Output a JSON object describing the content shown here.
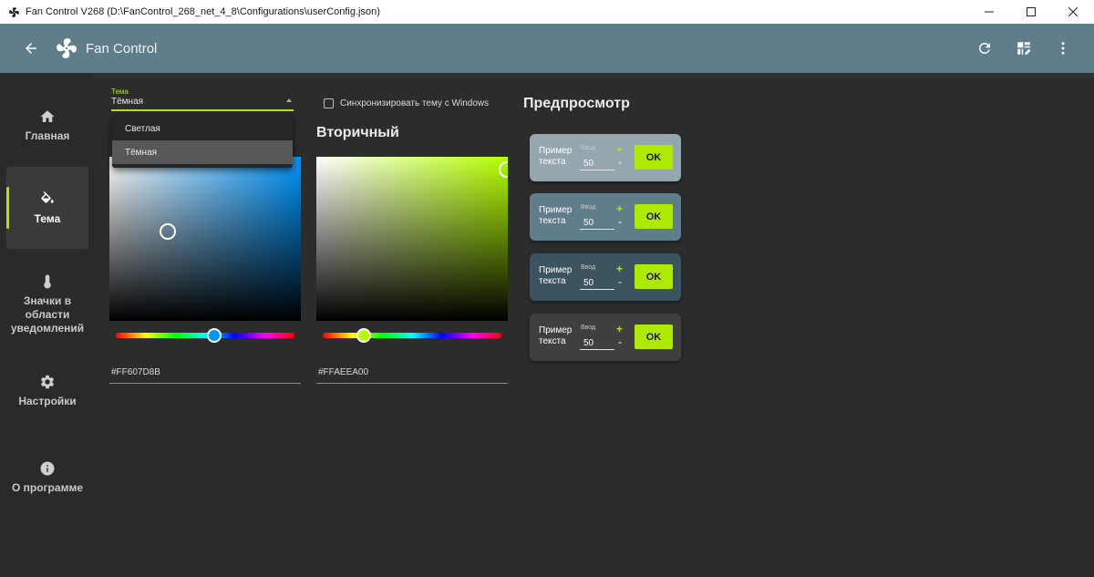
{
  "window": {
    "title": "Fan Control V268 (D:\\FanControl_268_net_4_8\\Configurations\\userConfig.json)"
  },
  "appbar": {
    "title": "Fan Control",
    "icons": [
      "back-arrow-icon",
      "fan-logo-icon",
      "refresh-icon",
      "dashboard-edit-icon",
      "more-vertical-icon"
    ]
  },
  "sidebar": {
    "items": [
      {
        "label": "Главная",
        "icon": "home-icon"
      },
      {
        "label": "Тема",
        "icon": "paint-bucket-icon",
        "active": true
      },
      {
        "label": "Значки в области уведомлений",
        "icon": "thermometer-icon"
      },
      {
        "label": "Настройки",
        "icon": "gear-icon"
      },
      {
        "label": "О программе",
        "icon": "info-icon"
      }
    ]
  },
  "theme": {
    "label": "Тема",
    "value": "Тёмная",
    "options": [
      "Светлая",
      "Тёмная"
    ],
    "selected": "Тёмная",
    "sync_label": "Синхронизировать тему с Windows"
  },
  "primary": {
    "hex": "#FF607D8B",
    "color": "#607D8B"
  },
  "secondary": {
    "title": "Вторичный",
    "hex": "#FFAEEA00",
    "color": "#AEEA00"
  },
  "preview": {
    "title": "Предпросмотр",
    "text": "Пример текста",
    "input_label": "Ввод",
    "input_value": "50",
    "plus": "+",
    "minus": "-",
    "ok_label": "OK",
    "card_colors": [
      "#94a6ae",
      "#607d8b",
      "#3b5460",
      "#3f3f3f"
    ]
  },
  "colors": {
    "accent": "#AEEA00",
    "appbar": "#5F7D8B",
    "background": "#2C2C2C"
  }
}
